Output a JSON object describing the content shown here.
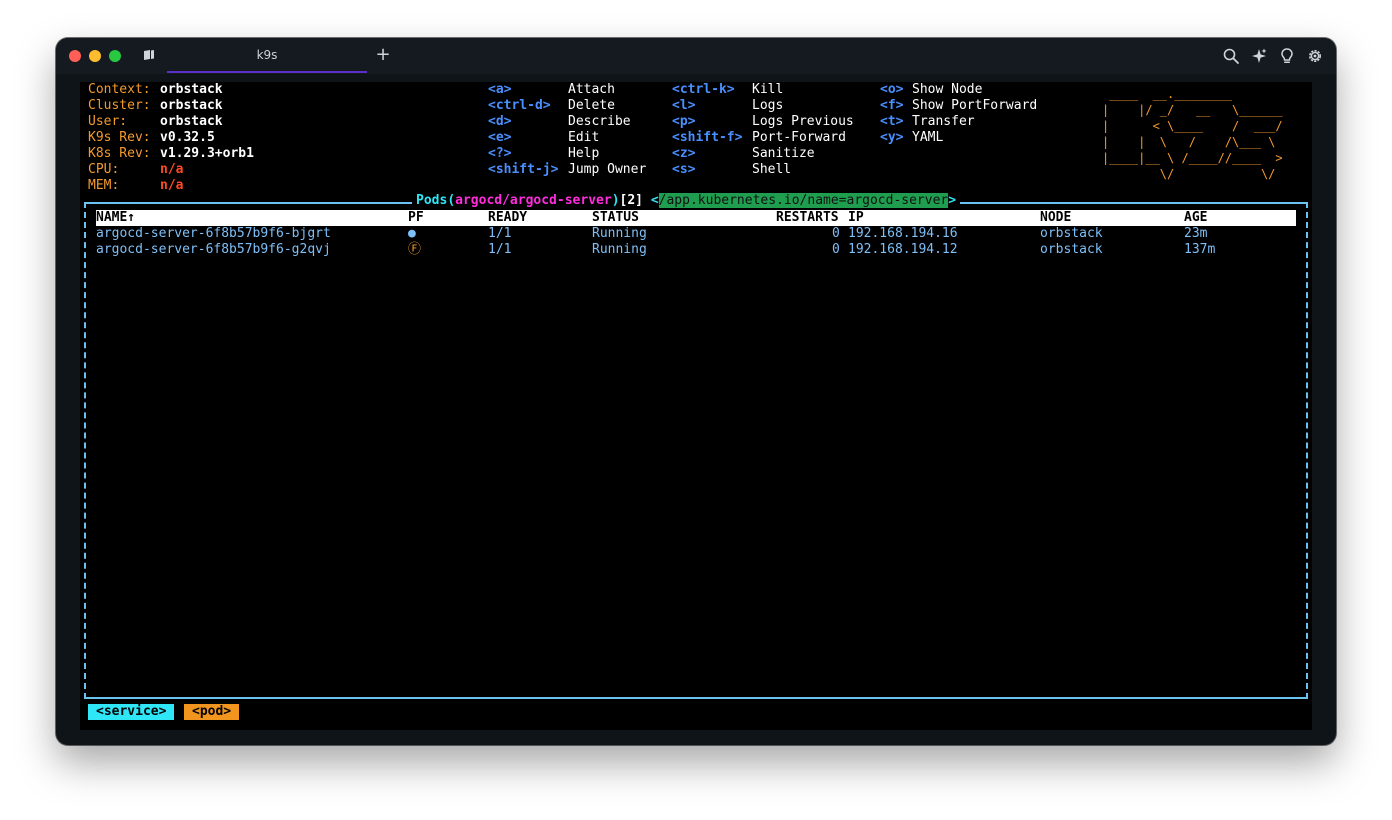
{
  "window": {
    "tab_title": "k9s",
    "new_tab_label": "+"
  },
  "info": [
    {
      "label": "Context:",
      "value": "orbstack",
      "status": "normal"
    },
    {
      "label": "Cluster:",
      "value": "orbstack",
      "status": "normal"
    },
    {
      "label": "User:",
      "value": "orbstack",
      "status": "normal"
    },
    {
      "label": "K9s Rev:",
      "value": "v0.32.5",
      "status": "normal"
    },
    {
      "label": "K8s Rev:",
      "value": "v1.29.3+orb1",
      "status": "normal"
    },
    {
      "label": "CPU:",
      "value": "n/a",
      "status": "na"
    },
    {
      "label": "MEM:",
      "value": "n/a",
      "status": "na"
    }
  ],
  "shortcuts": {
    "col1": [
      {
        "key": "<a>",
        "action": "Attach"
      },
      {
        "key": "<ctrl-d>",
        "action": "Delete"
      },
      {
        "key": "<d>",
        "action": "Describe"
      },
      {
        "key": "<e>",
        "action": "Edit"
      },
      {
        "key": "<?>",
        "action": "Help"
      },
      {
        "key": "<shift-j>",
        "action": "Jump Owner"
      }
    ],
    "col2": [
      {
        "key": "<ctrl-k>",
        "action": "Kill"
      },
      {
        "key": "<l>",
        "action": "Logs"
      },
      {
        "key": "<p>",
        "action": "Logs Previous"
      },
      {
        "key": "<shift-f>",
        "action": "Port-Forward"
      },
      {
        "key": "<z>",
        "action": "Sanitize"
      },
      {
        "key": "<s>",
        "action": "Shell"
      }
    ],
    "col3": [
      {
        "key": "<o>",
        "action": "Show Node"
      },
      {
        "key": "<f>",
        "action": "Show PortForward"
      },
      {
        "key": "<t>",
        "action": "Transfer"
      },
      {
        "key": "<y>",
        "action": "YAML"
      }
    ]
  },
  "logo": " ____  __.________       \n|    |/ _/   __   \\______\n|      < \\____    /  ___/\n|    |  \\   /    /\\___ \\ \n|____|__ \\ /____//____  >\n        \\/            \\/ ",
  "pods_view": {
    "resource": "Pods",
    "open_paren": "(",
    "namespace": "argocd/argocd-server",
    "close_paren": ")",
    "count": "[2]",
    "filter_open": "<",
    "filter": "/app.kubernetes.io/name=argocd-server",
    "filter_close": ">"
  },
  "table": {
    "columns": [
      "NAME↑",
      "PF",
      "READY",
      "STATUS",
      "RESTARTS",
      "IP",
      "NODE",
      "AGE"
    ],
    "rows": [
      {
        "name": "argocd-server-6f8b57b9f6-bjgrt",
        "pf": "●",
        "ready": "1/1",
        "status": "Running",
        "restarts": "0",
        "ip": "192.168.194.16",
        "node": "orbstack",
        "age": "23m"
      },
      {
        "name": "argocd-server-6f8b57b9f6-g2qvj",
        "pf": "Ⓕ",
        "ready": "1/1",
        "status": "Running",
        "restarts": "0",
        "ip": "192.168.194.12",
        "node": "orbstack",
        "age": "137m"
      }
    ]
  },
  "crumbs": [
    "<service>",
    "<pod>"
  ],
  "colors": {
    "label_orange": "#f29a2e",
    "key_blue": "#4a8fff",
    "frame_cyan": "#6bc1f0",
    "namespace_magenta": "#ff2cde",
    "filter_green": "#1f9e4f",
    "row_text": "#7fbff7",
    "na_red": "#ff4a1f"
  },
  "icons": [
    "tab-icon",
    "search-icon",
    "sparkle-icon",
    "lightbulb-icon",
    "gear-icon"
  ]
}
